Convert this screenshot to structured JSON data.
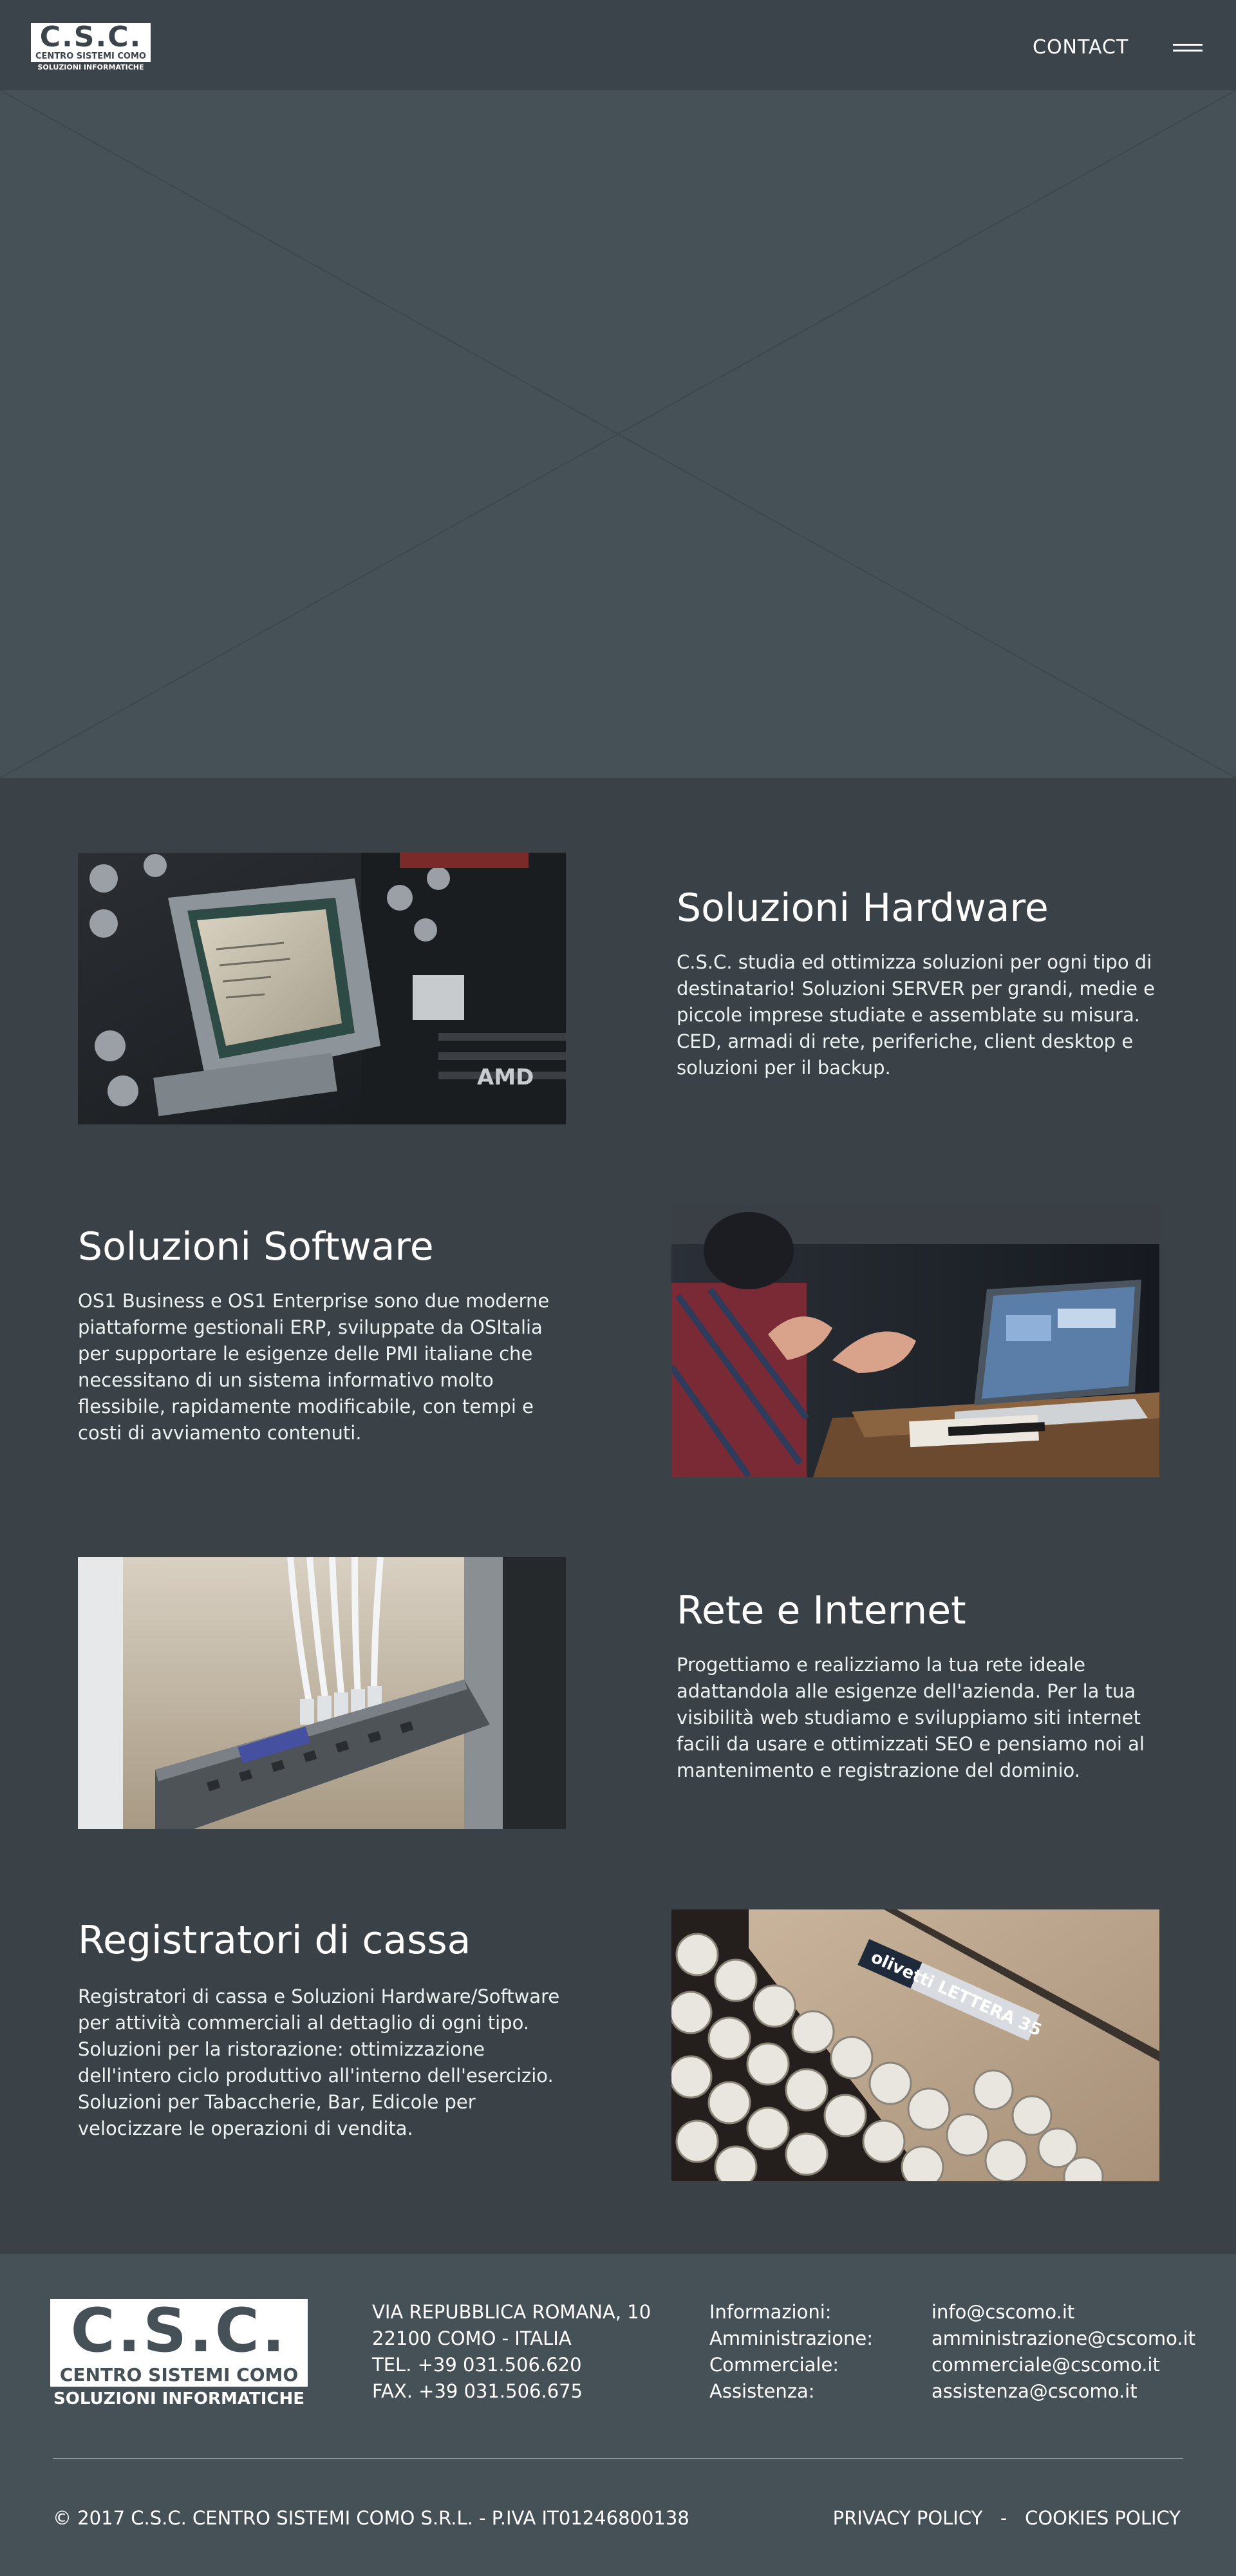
{
  "header": {
    "logo": {
      "letters": "C.S.C.",
      "line1": "CENTRO SISTEMI COMO",
      "line2": "SOLUZIONI INFORMATICHE"
    },
    "contact_label": "CONTACT",
    "menu_icon": "hamburger-menu-icon"
  },
  "hero": {
    "image": "image-placeholder"
  },
  "features": [
    {
      "title": "Soluzioni Hardware",
      "text": "C.S.C. studia ed ottimizza soluzioni per ogni tipo di destinatario! Soluzioni SERVER per grandi, medie e piccole imprese studiate e assemblate su misura. CED, armadi di rete, periferiche, client desktop e soluzioni per il backup.",
      "image": "cpu-motherboard-photo",
      "image_side": "left"
    },
    {
      "title": "Soluzioni Software",
      "text": "OS1 Business e OS1 Enterprise sono due moderne piattaforme gestionali ERP, sviluppate da OSItalia per supportare le esigenze delle PMI italiane che necessitano di un sistema informativo molto flessibile, rapidamente modificabile, con tempi e costi di avviamento contenuti.",
      "image": "laptop-meeting-photo",
      "image_side": "right"
    },
    {
      "title": "Rete e Internet",
      "text": "Progettiamo e realizziamo la tua rete ideale adattandola alle esigenze dell'azienda. Per la tua visibilità web studiamo e sviluppiamo siti internet facili da usare e ottimizzati SEO e pensiamo noi al mantenimento e registrazione del dominio.",
      "image": "network-switch-cables-photo",
      "image_side": "left"
    },
    {
      "title": "Registratori di cassa",
      "text": "Registratori di cassa e Soluzioni Hardware/Software per attività commerciali al dettaglio di ogni tipo. Soluzioni per la ristorazione: ottimizzazione dell'intero ciclo produttivo all'interno dell'esercizio. Soluzioni per Tabaccherie, Bar, Edicole per velocizzare le operazioni di vendita.",
      "image": "olivetti-typewriter-photo",
      "image_side": "right",
      "image_text": "olivetti LETTERA 35"
    }
  ],
  "footer": {
    "logo": {
      "letters": "C.S.C.",
      "line1": "CENTRO SISTEMI COMO",
      "line2": "SOLUZIONI INFORMATICHE"
    },
    "address": [
      "VIA REPUBBLICA ROMANA, 10",
      "22100 COMO - ITALIA",
      "TEL. +39 031.506.620",
      "FAX. +39 031.506.675"
    ],
    "contact_labels": [
      "Informazioni:",
      "Amministrazione:",
      "Commerciale:",
      "Assistenza:"
    ],
    "contact_emails": [
      "info@cscomo.it",
      "amministrazione@cscomo.it",
      "commerciale@cscomo.it",
      "assistenza@cscomo.it"
    ],
    "copyright": "© 2017 C.S.C. CENTRO SISTEMI COMO S.R.L. - P.IVA IT01246800138",
    "privacy_label": "PRIVACY POLICY",
    "separator": "-",
    "cookies_label": "COOKIES POLICY"
  },
  "colors": {
    "header_bg": "#3b444a",
    "page_bg": "#3a4248",
    "hero_bg": "#465157",
    "footer_bg": "#465157",
    "text": "#ffffff"
  }
}
